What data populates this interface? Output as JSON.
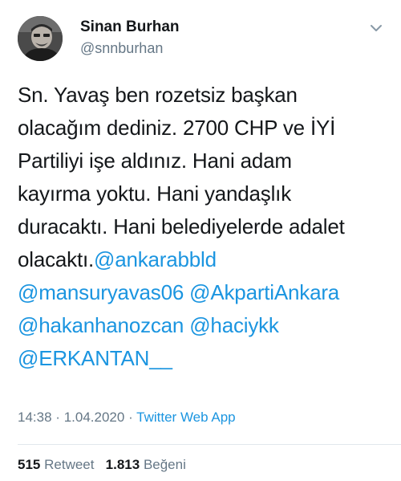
{
  "user": {
    "display_name": "Sinan Burhan",
    "handle": "@snnburhan"
  },
  "tweet": {
    "text_lines": [
      "Sn. Yavaş ben rozetsiz başkan",
      "olacağım dediniz. 2700 CHP ve İYİ",
      "Partiliyi işe aldınız. Hani adam",
      "kayırma yoktu. Hani yandaşlık",
      "duracaktı. Hani belediyelerde adalet",
      "olacaktı."
    ],
    "mentions": [
      "@ankarabbld",
      "@mansuryavas06",
      "@AkpartiAnkara",
      "@hakanhanozcan",
      "@haciykk",
      "@ERKANTAN__"
    ],
    "time": "14:38",
    "separator": "·",
    "date": "1.04.2020",
    "source": "Twitter Web App"
  },
  "stats": {
    "retweet_count": "515",
    "retweet_label": "Retweet",
    "like_count": "1.813",
    "like_label": "Beğeni"
  },
  "icons": {
    "avatar": "avatar-photo",
    "menu": "chevron-down-icon"
  },
  "colors": {
    "link": "#1b95e0",
    "secondary": "#657786",
    "primary_text": "#14171a",
    "divider": "#e1e8ed"
  }
}
